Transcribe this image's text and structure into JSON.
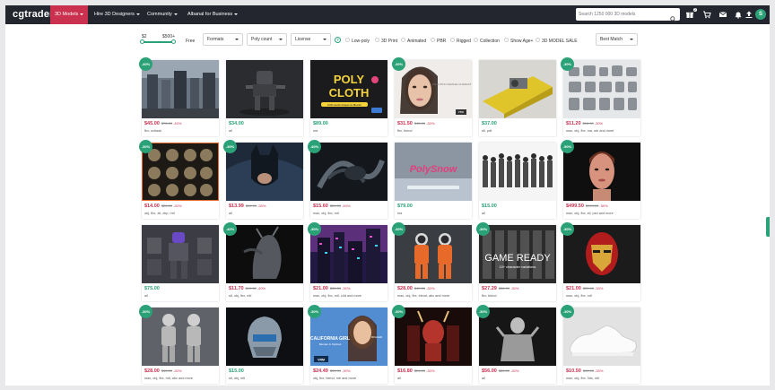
{
  "brand": {
    "logo": "cgtrader",
    "accent": "#c9314e",
    "green": "#2aa177",
    "nav_bg": "#23252f"
  },
  "nav": {
    "items": [
      {
        "label": "3D Models"
      },
      {
        "label": "Hire 3D Designers"
      },
      {
        "label": "Community"
      },
      {
        "label": "Albanal for Business"
      }
    ],
    "search_placeholder": "Search 1250 000 3D models",
    "notification_count": "2",
    "avatar_initial": "S",
    "icons": [
      "search-icon",
      "gift-icon",
      "cart-icon",
      "mail-icon",
      "bell-icon",
      "upload-icon"
    ]
  },
  "filters": {
    "price_min": "$2",
    "price_max": "$500+",
    "slider_min_pct": 0,
    "slider_max_pct": 100,
    "free": "Free",
    "formats": "Formats",
    "poly_count": "Poly count",
    "license": "License",
    "help": "?",
    "low_poly": "Low-poly",
    "print_3d": "3D Print",
    "animated": "Animated",
    "pbr": "PBR",
    "rigged": "Rigged",
    "collection": "Collection",
    "show_age": "Show Age+",
    "sale": "3D MODEL SALE",
    "sort": "Best Match"
  },
  "products": [
    {
      "discount": "-40%",
      "price": "$45.00",
      "old": "$75.00",
      "pct": "-40%",
      "formats": "fbx, unitask",
      "theme": "city"
    },
    {
      "discount": "",
      "price": "$34.00",
      "old": "",
      "pct": "",
      "formats": "all",
      "theme": "robot"
    },
    {
      "discount": "",
      "price": "$89.00",
      "old": "",
      "pct": "",
      "formats": "ma",
      "theme": "polycloth"
    },
    {
      "discount": "-30%",
      "price": "$31.50",
      "old": "$45.00",
      "pct": "-30%",
      "formats": "fbx, blend",
      "theme": "face"
    },
    {
      "discount": "",
      "price": "$37.00",
      "old": "",
      "pct": "",
      "formats": "stl, pdf",
      "theme": "machine"
    },
    {
      "discount": "-30%",
      "price": "$11.20",
      "old": "$16.00",
      "pct": "-30%",
      "formats": "max, obj, fbx, ma, mb and more",
      "theme": "parts"
    },
    {
      "discount": "-30%",
      "price": "$14.00",
      "old": "$20.00",
      "pct": "-30%",
      "formats": "obj, fbx, ztl, zbp, mtl",
      "theme": "ornament"
    },
    {
      "discount": "-30%",
      "price": "$13.99",
      "old": "$19.99",
      "pct": "-30%",
      "formats": "all",
      "theme": "batman"
    },
    {
      "discount": "-40%",
      "price": "$15.60",
      "old": "$26.00",
      "pct": "-40%",
      "formats": "max, obj, fbx, mtl",
      "theme": "dragon"
    },
    {
      "discount": "",
      "price": "$79.00",
      "old": "",
      "pct": "",
      "formats": "ma",
      "theme": "polysnow"
    },
    {
      "discount": "",
      "price": "$15.00",
      "old": "",
      "pct": "",
      "formats": "all",
      "theme": "soldiers"
    },
    {
      "discount": "-50%",
      "price": "$499.50",
      "old": "$999.00",
      "pct": "-50%",
      "formats": "max, obj, fbx, ztl, psd and more",
      "theme": "woman"
    },
    {
      "discount": "",
      "price": "$75.00",
      "old": "",
      "pct": "",
      "formats": "all",
      "theme": "armor"
    },
    {
      "discount": "-40%",
      "price": "$11.70",
      "old": "$19.50",
      "pct": "-40%",
      "formats": "stl, obj, fbx, mtl",
      "theme": "creature"
    },
    {
      "discount": "-30%",
      "price": "$21.00",
      "old": "$30.00",
      "pct": "-30%",
      "formats": "max, obj, fbx, mtl, c4d and more",
      "theme": "neon"
    },
    {
      "discount": "-30%",
      "price": "$28.00",
      "old": "$40.00",
      "pct": "-30%",
      "formats": "max, obj, fbx, blend, abc and more",
      "theme": "astronaut"
    },
    {
      "discount": "-30%",
      "price": "$27.29",
      "old": "$38.99",
      "pct": "-30%",
      "formats": "fbx, blend",
      "theme": "gameready"
    },
    {
      "discount": "-30%",
      "price": "$21.00",
      "old": "$30.00",
      "pct": "-30%",
      "formats": "max, obj, fbx, mtl",
      "theme": "ironman"
    },
    {
      "discount": "-30%",
      "price": "$28.00",
      "old": "$40.00",
      "pct": "-30%",
      "formats": "max, obj, fbx, mtl, abc and more",
      "theme": "astros"
    },
    {
      "discount": "",
      "price": "$15.00",
      "old": "",
      "pct": "",
      "formats": "stl, obj, mtl",
      "theme": "helmet"
    },
    {
      "discount": "-30%",
      "price": "$24.49",
      "old": "$34.99",
      "pct": "-30%",
      "formats": "obj, fbx, blend, mb and more",
      "theme": "california"
    },
    {
      "discount": "-30%",
      "price": "$16.80",
      "old": "$24.00",
      "pct": "-30%",
      "formats": "all",
      "theme": "demon"
    },
    {
      "discount": "-30%",
      "price": "$56.00",
      "old": "$80.00",
      "pct": "-30%",
      "formats": "all",
      "theme": "warrior"
    },
    {
      "discount": "-30%",
      "price": "$10.50",
      "old": "$15.00",
      "pct": "-30%",
      "formats": "max, obj, fbx, 3ds, mtl",
      "theme": "sneaker"
    }
  ],
  "thumb_text": {
    "polycloth_title": "POLY CLOTH",
    "polycloth_sub": "1000 Houdini shapes for Blender",
    "face_sub": "REALISTIC FEMALE CHARACTER",
    "polysnow_title": "PolySnow",
    "gameready_title": "GAME READY",
    "gameready_sub": "10+ character variations",
    "california_title": "CALIFORNIA GIRL",
    "california_sub": "Blender & Stylized",
    "california_tag": "RIGGED",
    "california_brand": "VRM",
    "pbr_tag": "PBR"
  }
}
